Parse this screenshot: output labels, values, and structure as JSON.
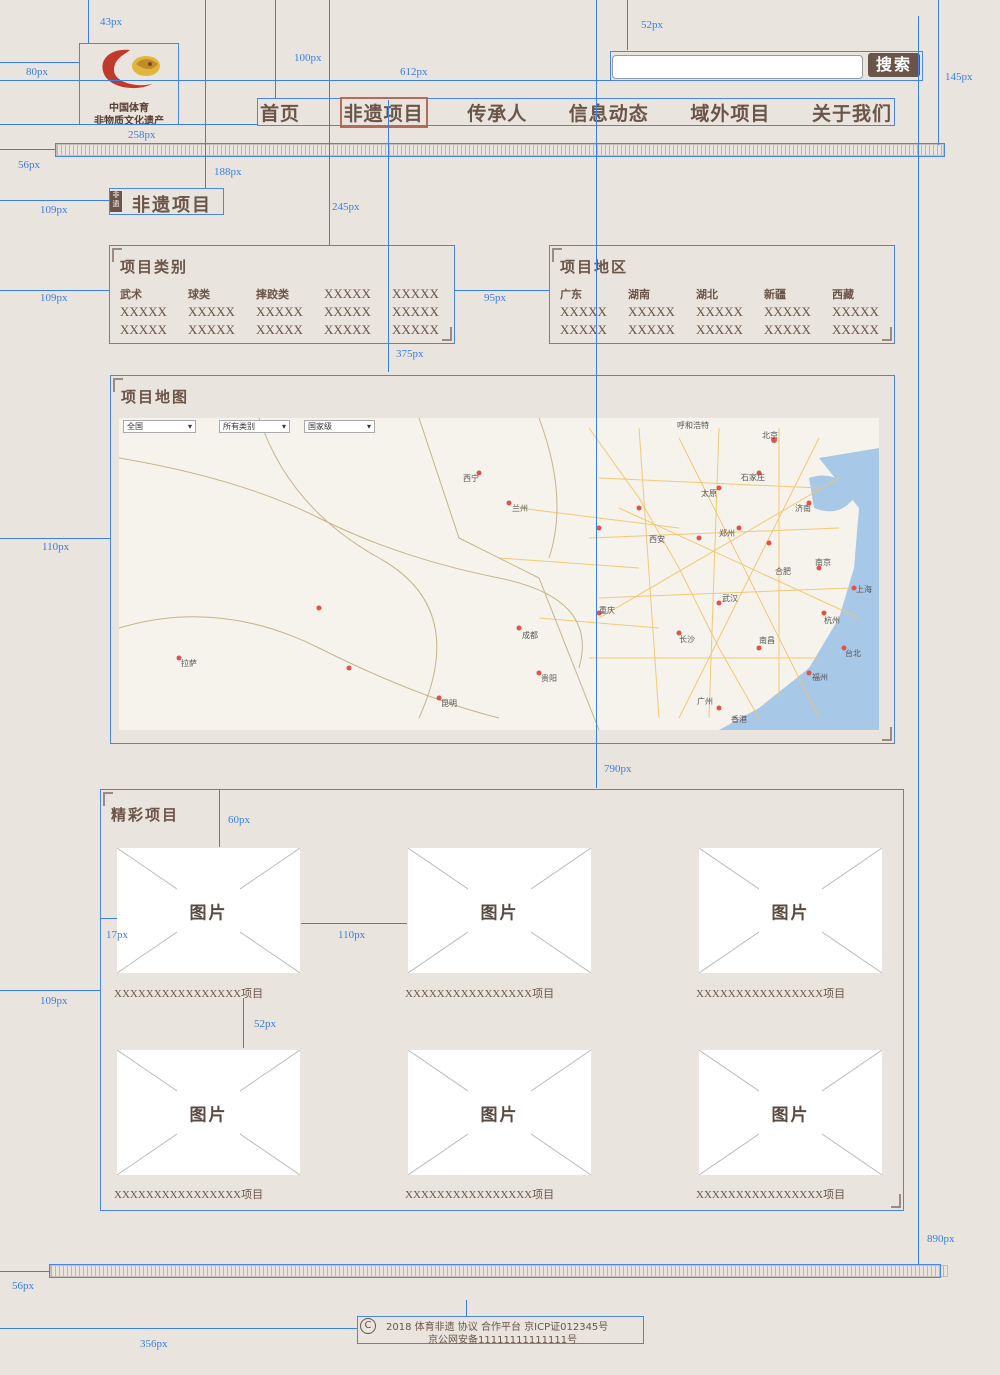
{
  "logo": {
    "line1": "中国体育",
    "line2": "非物质文化遗产"
  },
  "search": {
    "placeholder": "",
    "button": "搜索"
  },
  "nav": {
    "items": [
      "首页",
      "非遗项目",
      "传承人",
      "信息动态",
      "域外项目",
      "关于我们"
    ],
    "active_index": 1
  },
  "section": {
    "tag": "非遗",
    "title": "非遗项目"
  },
  "category_panel": {
    "title": "项目类别",
    "headers": [
      "武术",
      "球类",
      "摔跤类",
      "XXXXX",
      "XXXXX"
    ],
    "rows": [
      [
        "XXXXX",
        "XXXXX",
        "XXXXX",
        "XXXXX",
        "XXXXX"
      ],
      [
        "XXXXX",
        "XXXXX",
        "XXXXX",
        "XXXXX",
        "XXXXX"
      ]
    ]
  },
  "region_panel": {
    "title": "项目地区",
    "headers": [
      "广东",
      "湖南",
      "湖北",
      "新疆",
      "西藏"
    ],
    "rows": [
      [
        "XXXXX",
        "XXXXX",
        "XXXXX",
        "XXXXX",
        "XXXXX"
      ],
      [
        "XXXXX",
        "XXXXX",
        "XXXXX",
        "XXXXX",
        "XXXXX"
      ]
    ]
  },
  "map_panel": {
    "title": "项目地图",
    "filters": [
      "全国",
      "所有类别",
      "国家级"
    ],
    "place_labels": [
      "北京",
      "石家庄",
      "太原",
      "济南",
      "郑州",
      "西安",
      "合肥",
      "南京",
      "上海",
      "杭州",
      "武汉",
      "长沙",
      "南昌",
      "福州",
      "广州",
      "香港",
      "台北",
      "重庆",
      "成都",
      "贵阳",
      "昆明",
      "兰州",
      "西宁",
      "拉萨",
      "呼和浩特"
    ]
  },
  "featured": {
    "title": "精彩项目",
    "items": [
      {
        "image_text": "图片",
        "caption": "XXXXXXXXXXXXXXXX项目"
      },
      {
        "image_text": "图片",
        "caption": "XXXXXXXXXXXXXXXX项目"
      },
      {
        "image_text": "图片",
        "caption": "XXXXXXXXXXXXXXXX项目"
      },
      {
        "image_text": "图片",
        "caption": "XXXXXXXXXXXXXXXX项目"
      },
      {
        "image_text": "图片",
        "caption": "XXXXXXXXXXXXXXXX项目"
      },
      {
        "image_text": "图片",
        "caption": "XXXXXXXXXXXXXXXX项目"
      }
    ]
  },
  "footer": {
    "copyright_symbol": "C",
    "line1": "2018  体育非遗  协议  合作平台  京ICP证012345号",
    "line2": "京公网安备11111111111111号"
  },
  "annotations": [
    "43px",
    "80px",
    "100px",
    "612px",
    "52px",
    "145px",
    "258px",
    "56px",
    "188px",
    "109px",
    "245px",
    "109px",
    "95px",
    "375px",
    "110px",
    "790px",
    "60px",
    "17px",
    "110px",
    "109px",
    "52px",
    "890px",
    "56px",
    "356px"
  ],
  "colors": {
    "background": "#e9e4dd",
    "text": "#6b5548",
    "accent_button": "#6b554a",
    "guide": "#3a7ee6"
  }
}
